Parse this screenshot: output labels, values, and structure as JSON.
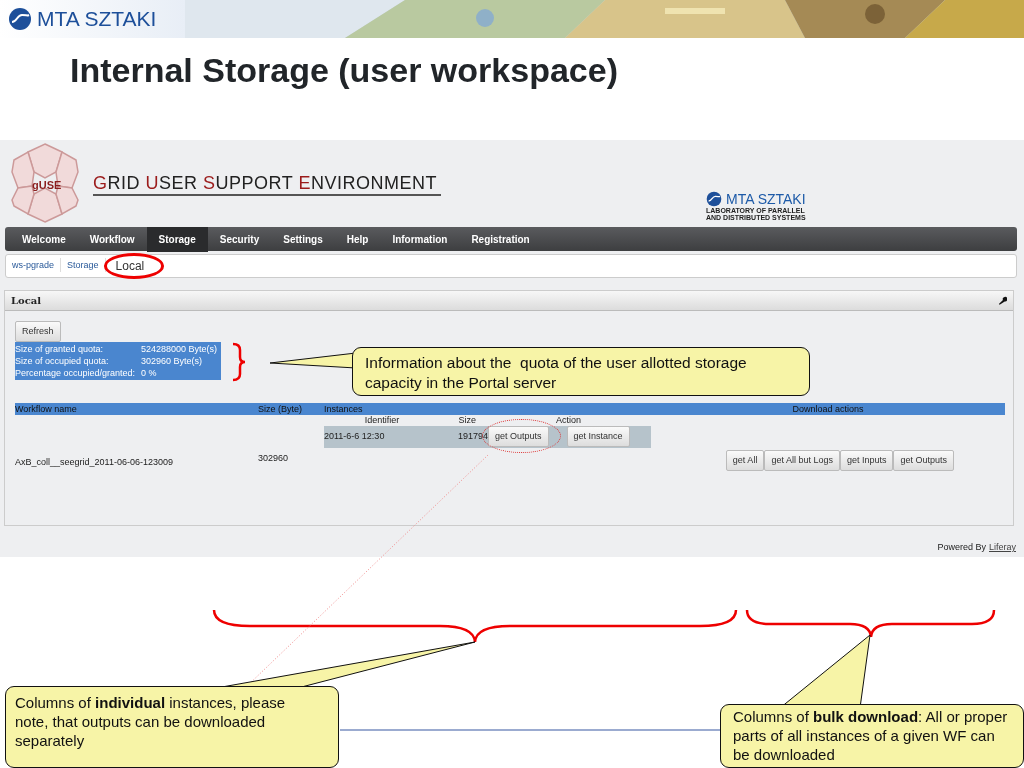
{
  "slide": {
    "logo_text": "MTA SZTAKI",
    "title": "Internal Storage (user workspace)"
  },
  "portal": {
    "badge": "gUSE",
    "banner_words": [
      "GRID",
      "USER",
      "SUPPORT",
      "ENVIRONMENT"
    ],
    "lab_logo": {
      "name": "MTA SZTAKI",
      "lines": [
        "LABORATORY OF PARALLEL",
        "AND DISTRIBUTED SYSTEMS"
      ]
    },
    "nav": [
      {
        "label": "Welcome",
        "selected": false
      },
      {
        "label": "Workflow",
        "selected": false
      },
      {
        "label": "Storage",
        "selected": true
      },
      {
        "label": "Security",
        "selected": false
      },
      {
        "label": "Settings",
        "selected": false
      },
      {
        "label": "Help",
        "selected": false
      },
      {
        "label": "Information",
        "selected": false
      },
      {
        "label": "Registration",
        "selected": false
      }
    ],
    "breadcrumb": [
      {
        "label": "ws-pgrade",
        "selected": false,
        "circled": false
      },
      {
        "label": "Storage",
        "selected": false,
        "circled": false
      },
      {
        "label": "Local",
        "selected": true,
        "circled": true
      }
    ],
    "portlet": {
      "title": "Local",
      "refresh_button": "Refresh",
      "quota": [
        {
          "label": "Size of granted quota:",
          "value": "524288000 Byte(s)"
        },
        {
          "label": "Size of occupied quota:",
          "value": "302960 Byte(s)"
        },
        {
          "label": "Percentage occupied/granted:",
          "value": "0 %"
        }
      ],
      "table": {
        "columns": [
          "Workflow name",
          "Size (Byte)",
          "Instances",
          "Download actions"
        ],
        "instance_columns": [
          "Identifier",
          "Size",
          "Action"
        ],
        "rows": [
          {
            "workflow_name": "AxB_coll__seegrid_2011-06-06-123009",
            "size": "302960",
            "instances": [
              {
                "identifier": "2011-6-6 12:30",
                "size": "191794",
                "actions": [
                  {
                    "label": "get Outputs",
                    "circled": true
                  },
                  {
                    "label": "get Instance",
                    "circled": false
                  }
                ]
              }
            ],
            "download_actions": [
              "get All",
              "get All but Logs",
              "get Inputs",
              "get Outputs"
            ]
          }
        ]
      }
    },
    "footer": {
      "text": "Powered By",
      "link": "Liferay"
    }
  },
  "callouts": [
    {
      "kind": "quota",
      "text": "Information about the  quota of the user allotted storage capacity in the Portal server"
    },
    {
      "kind": "instances",
      "text": "Columns of **individual** instances, please note, that outputs can be downloaded separately"
    },
    {
      "kind": "bulk",
      "text": "Columns of **bulk download**: All or proper parts of all instances of a given WF can be downloaded"
    }
  ]
}
